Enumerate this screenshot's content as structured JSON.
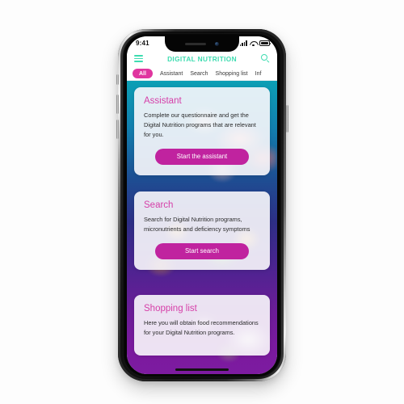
{
  "device": {
    "status_bar": {
      "time": "9:41",
      "signal_icon": "cellular-signal-icon",
      "wifi_icon": "wifi-icon",
      "battery_icon": "battery-full-icon"
    },
    "home_indicator": "home-indicator"
  },
  "app": {
    "header": {
      "menu_icon": "hamburger-menu-icon",
      "title": "DIGITAL NUTRITION",
      "search_icon": "search-icon",
      "accent_color": "#3ddcb0"
    },
    "tabs": [
      {
        "label": "All",
        "active": true
      },
      {
        "label": "Assistant",
        "active": false
      },
      {
        "label": "Search",
        "active": false
      },
      {
        "label": "Shopping list",
        "active": false
      },
      {
        "label": "Inf",
        "active": false
      }
    ],
    "tab_active_color": "#e0359f",
    "cards": [
      {
        "title": "Assistant",
        "body": "Complete our questionnaire and get the Digital Nutrition programs that are relevant for you.",
        "cta": "Start the assistant"
      },
      {
        "title": "Search",
        "body": "Search for Digital Nutrition programs, micronutrients and deficiency symptoms",
        "cta": "Start search"
      },
      {
        "title": "Shopping list",
        "body": "Here you will obtain food recommendations for your Digital Nutrition programs.",
        "cta": ""
      }
    ],
    "colors": {
      "card_title": "#d63fa8",
      "cta_button": "#c0239f",
      "bg_gradient_top": "#0c9fb5",
      "bg_gradient_bottom": "#7d1ba0"
    }
  }
}
